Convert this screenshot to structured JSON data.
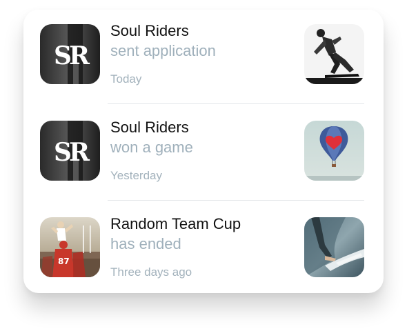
{
  "notifications": [
    {
      "title": "Soul Riders",
      "action": "sent application",
      "time": "Today",
      "avatar_icon": "soul-riders-logo",
      "thumb_icon": "skater-photo"
    },
    {
      "title": "Soul Riders",
      "action": "won a game",
      "time": "Yesterday",
      "avatar_icon": "soul-riders-logo",
      "thumb_icon": "hot-air-balloon-photo"
    },
    {
      "title": "Random Team Cup",
      "action": "has ended",
      "time": "Three days ago",
      "avatar_icon": "football-team-photo",
      "thumb_icon": "surfer-photo"
    }
  ],
  "colors": {
    "title": "#111111",
    "action": "#9fb0bb",
    "time": "#a3b2bc",
    "divider": "#e4e7ea",
    "card_bg": "#ffffff"
  }
}
